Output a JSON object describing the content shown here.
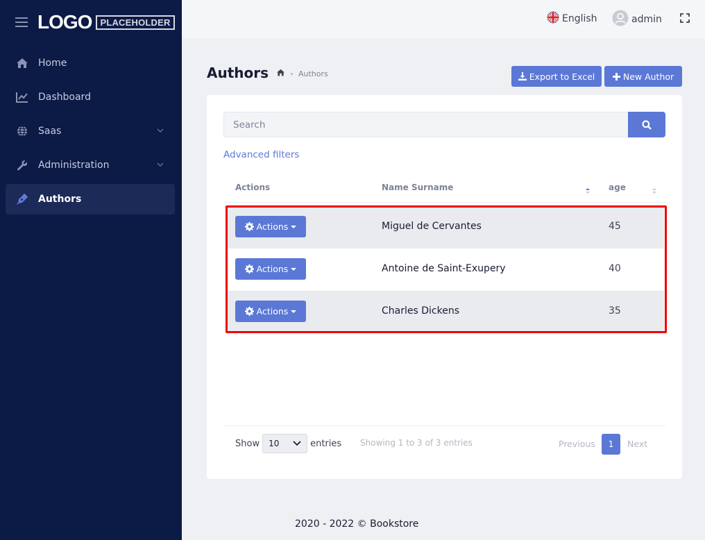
{
  "brand": {
    "logo": "LOGO",
    "logo_sub": "PLACEHOLDER"
  },
  "sidebar": {
    "items": [
      {
        "label": "Home",
        "icon": "home-icon"
      },
      {
        "label": "Dashboard",
        "icon": "chart-line-icon"
      },
      {
        "label": "Saas",
        "icon": "globe-icon",
        "has_children": true
      },
      {
        "label": "Administration",
        "icon": "wrench-icon",
        "has_children": true
      },
      {
        "label": "Authors",
        "icon": "pen-icon",
        "active": true
      }
    ]
  },
  "header": {
    "language": "English",
    "username": "admin"
  },
  "page": {
    "title": "Authors",
    "breadcrumb": [
      "Authors"
    ],
    "export_label": "Export to Excel",
    "new_label": "New Author"
  },
  "search": {
    "placeholder": "Search",
    "advanced_filters": "Advanced filters"
  },
  "table": {
    "columns": [
      "Actions",
      "Name Surname",
      "age"
    ],
    "action_label": "Actions",
    "rows": [
      {
        "name": "Miguel de Cervantes",
        "age": "45"
      },
      {
        "name": "Antoine de Saint-Exupery",
        "age": "40"
      },
      {
        "name": "Charles Dickens",
        "age": "35"
      }
    ]
  },
  "pagination": {
    "show_label": "Show",
    "page_size": "10",
    "entries_label": "entries",
    "info": "Showing 1 to 3 of 3 entries",
    "previous": "Previous",
    "current": "1",
    "next": "Next"
  },
  "footer": {
    "copyright": "2020 - 2022 © Bookstore"
  },
  "colors": {
    "sidebar_bg": "#0c1a46",
    "primary": "#5b78d6",
    "highlight": "#ee0000"
  }
}
